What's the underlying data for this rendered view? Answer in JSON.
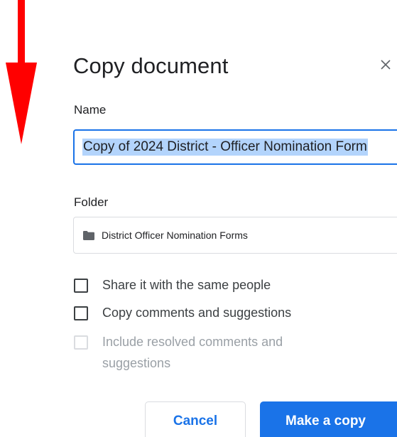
{
  "annotation": {
    "arrow_color": "#ff0000",
    "arrow_icon": "down-arrow"
  },
  "dialog": {
    "title": "Copy document",
    "close_icon": "close-icon",
    "name_label": "Name",
    "name_value": "Copy of 2024 District - Officer Nomination Form",
    "folder_label": "Folder",
    "folder_icon": "folder-icon",
    "folder_value": "District Officer Nomination Forms",
    "options": [
      {
        "label": "Share it with the same people",
        "checked": false,
        "disabled": false
      },
      {
        "label": "Copy comments and suggestions",
        "checked": false,
        "disabled": false
      },
      {
        "label": "Include resolved comments and suggestions",
        "checked": false,
        "disabled": true
      }
    ],
    "cancel_label": "Cancel",
    "confirm_label": "Make a copy"
  },
  "colors": {
    "accent": "#1a73e8",
    "selection": "#b3d4fc",
    "disabled_text": "#9aa0a6"
  }
}
